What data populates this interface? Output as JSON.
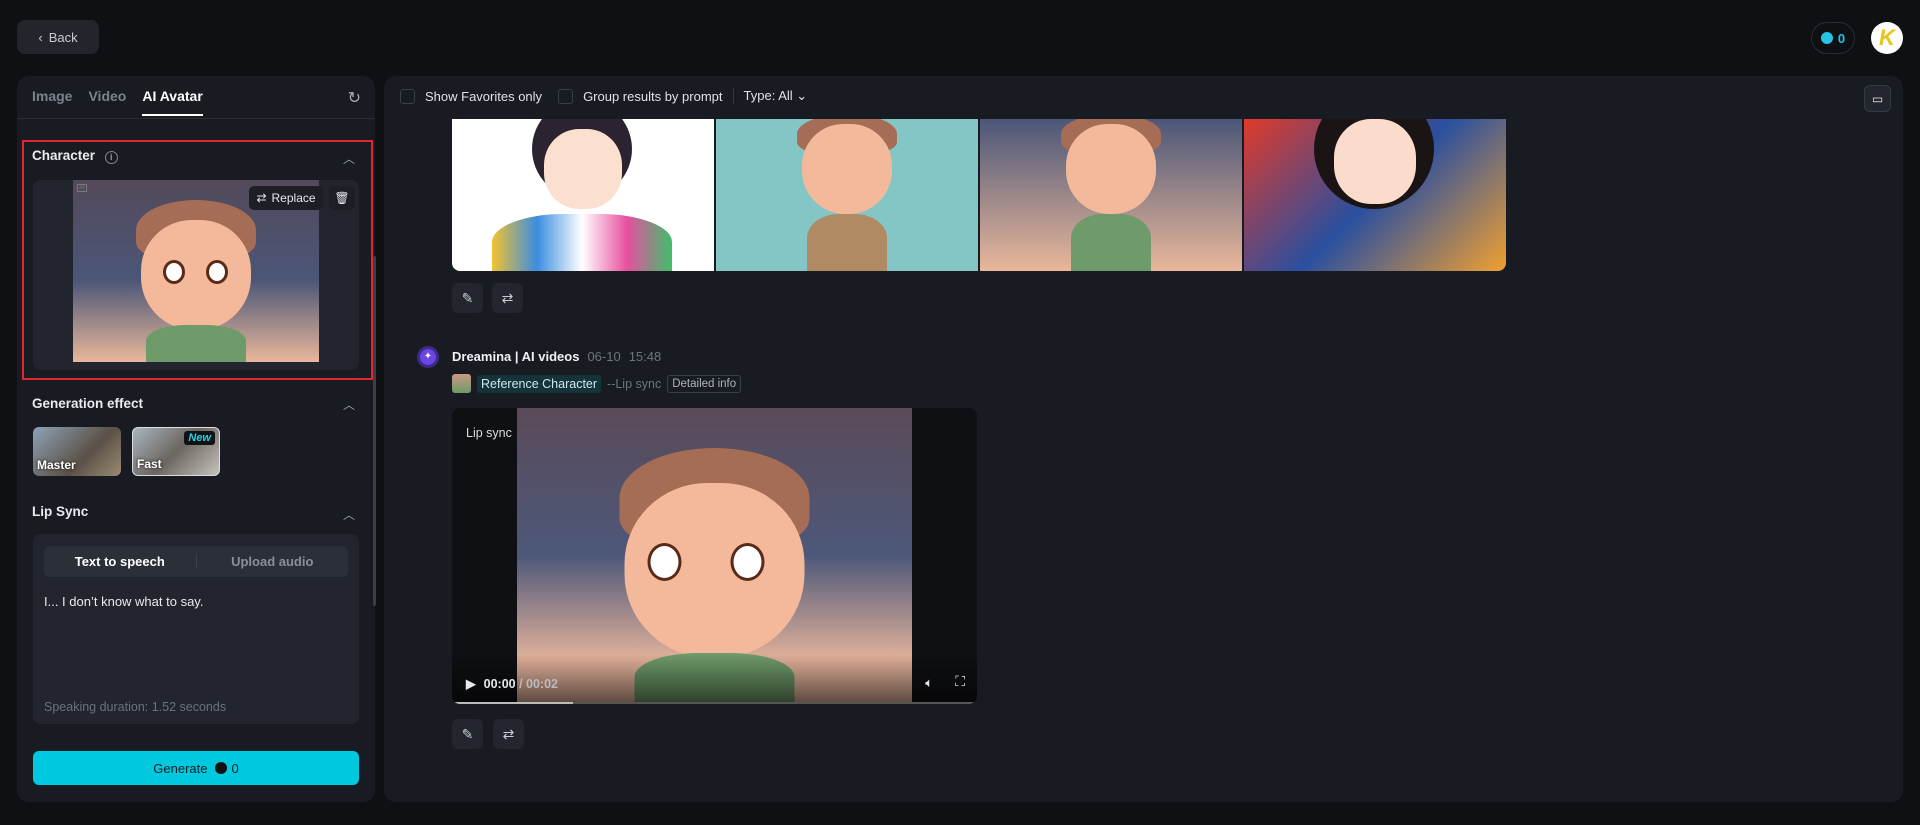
{
  "header": {
    "back_label": "Back",
    "credits": "0",
    "avatar_letter": "K"
  },
  "left": {
    "tabs": [
      "Image",
      "Video",
      "AI Avatar"
    ],
    "character": {
      "title": "Character",
      "replace_label": "Replace",
      "image_badge": "AI"
    },
    "generation_effect": {
      "title": "Generation effect",
      "options": [
        {
          "label": "Master"
        },
        {
          "label": "Fast",
          "badge": "New"
        }
      ]
    },
    "lip_sync": {
      "title": "Lip Sync",
      "modes": [
        "Text to speech",
        "Upload audio"
      ],
      "text": "I... I don’t know what to say.",
      "duration": "Speaking duration: 1.52 seconds"
    },
    "generate": {
      "label": "Generate",
      "cost": "0"
    }
  },
  "main": {
    "toolbar": {
      "show_favorites": "Show Favorites only",
      "group_by_prompt": "Group results by prompt",
      "type_filter": "Type: All"
    },
    "result": {
      "author": "Dreamina | AI videos",
      "date": "06-10",
      "time": "15:48",
      "ref_label": "Reference Character",
      "mode": "--Lip sync",
      "detail": "Detailed info"
    },
    "video": {
      "overlay": "Lip sync",
      "current": "00:00",
      "duration": "00:02",
      "progress": 0.23
    },
    "colors": {
      "accent": "#00c8df",
      "highlight": "#e3262b"
    }
  }
}
